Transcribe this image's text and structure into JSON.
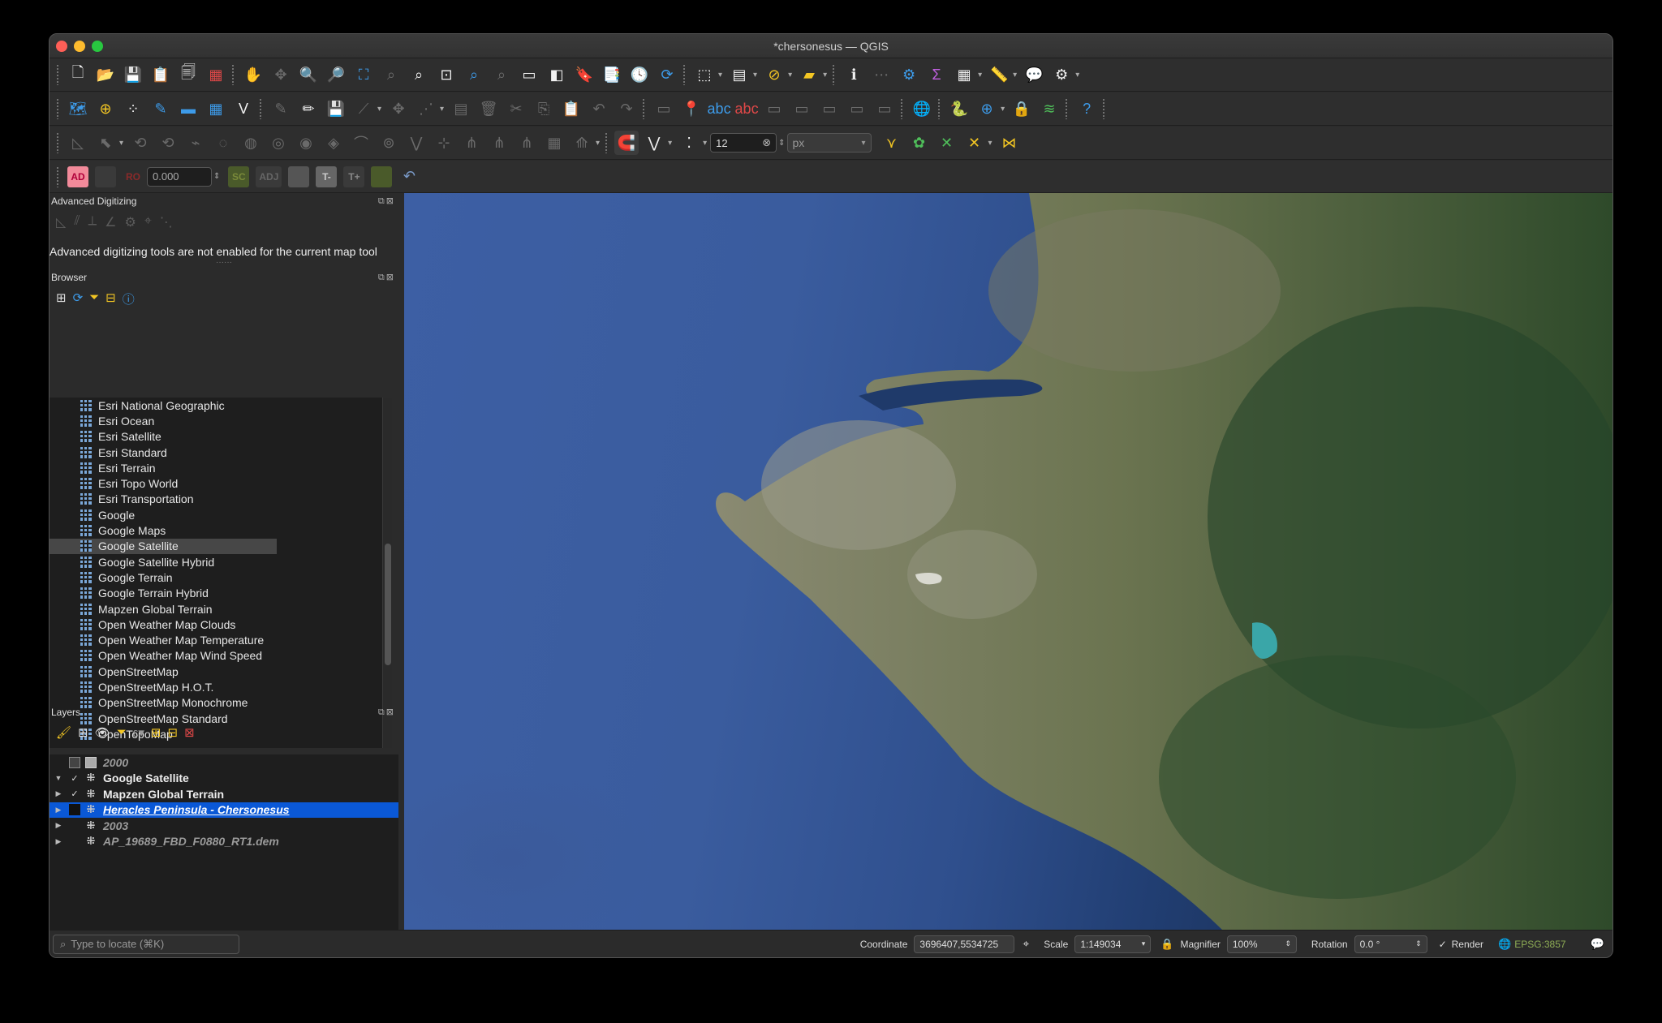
{
  "window": {
    "title": "*chersonesus — QGIS"
  },
  "toolbar3": {
    "snap_tolerance": "12",
    "snap_unit": "px"
  },
  "digitizing_toolbar": {
    "ad": "AD",
    "ro": "RO",
    "value": "0.000",
    "sc": "SC",
    "adj": "ADJ",
    "t_minus": "T-",
    "t_plus": "T+"
  },
  "advanced_digitizing": {
    "title": "Advanced Digitizing",
    "message": "Advanced digitizing tools are not enabled for the current map tool"
  },
  "browser": {
    "title": "Browser",
    "items": [
      {
        "label": "Esri National Geographic"
      },
      {
        "label": "Esri Ocean"
      },
      {
        "label": "Esri Satellite"
      },
      {
        "label": "Esri Standard"
      },
      {
        "label": "Esri Terrain"
      },
      {
        "label": "Esri Topo World"
      },
      {
        "label": "Esri Transportation"
      },
      {
        "label": "Google"
      },
      {
        "label": "Google Maps"
      },
      {
        "label": "Google Satellite",
        "selected": true
      },
      {
        "label": "Google Satellite Hybrid"
      },
      {
        "label": "Google Terrain"
      },
      {
        "label": "Google Terrain Hybrid"
      },
      {
        "label": "Mapzen Global Terrain"
      },
      {
        "label": "Open Weather Map Clouds"
      },
      {
        "label": "Open Weather Map Temperature"
      },
      {
        "label": "Open Weather Map Wind Speed"
      },
      {
        "label": "OpenStreetMap"
      },
      {
        "label": "OpenStreetMap H.O.T."
      },
      {
        "label": "OpenStreetMap Monochrome"
      },
      {
        "label": "OpenStreetMap Standard"
      },
      {
        "label": "OpenTopoMap"
      }
    ]
  },
  "layers": {
    "title": "Layers",
    "items": [
      {
        "name": "2000",
        "italic": true,
        "checked": false,
        "expandable": false
      },
      {
        "name": "Google Satellite",
        "italic": false,
        "checked": true,
        "expandable": true,
        "expanded": true
      },
      {
        "name": "Mapzen Global Terrain",
        "italic": false,
        "checked": true,
        "expandable": true
      },
      {
        "name": "Heracles Peninsula - Chersonesus",
        "italic": true,
        "checked": false,
        "expandable": true,
        "selected": true
      },
      {
        "name": "2003",
        "italic": true,
        "checked": false,
        "expandable": true
      },
      {
        "name": "AP_19689_FBD_F0880_RT1.dem",
        "italic": true,
        "checked": false,
        "expandable": true
      }
    ]
  },
  "statusbar": {
    "locate_placeholder": "Type to locate (⌘K)",
    "coordinate_label": "Coordinate",
    "coordinate_value": "3696407,5534725",
    "scale_label": "Scale",
    "scale_value": "1:149034",
    "magnifier_label": "Magnifier",
    "magnifier_value": "100%",
    "rotation_label": "Rotation",
    "rotation_value": "0.0 °",
    "render_label": "Render",
    "crs": "EPSG:3857"
  },
  "colors": {
    "selection": "#0a58d6",
    "sea": "#2f4f8d",
    "land": "#4a5a3a"
  }
}
